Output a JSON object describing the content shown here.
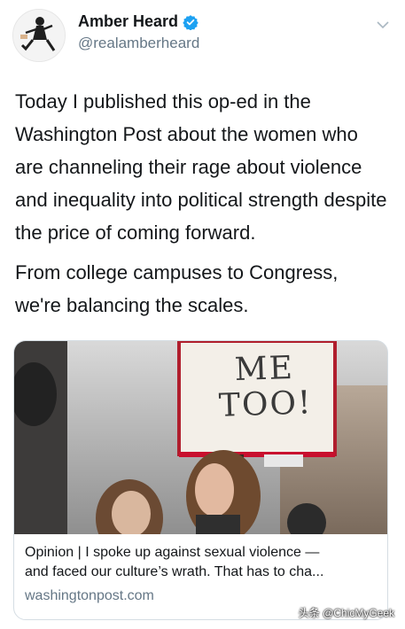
{
  "tweet": {
    "display_name": "Amber Heard",
    "handle": "@realamberheard",
    "text_paragraphs": [
      "Today I published this op-ed in the Washington Post about the women who are channeling their rage about violence and inequality into political strength despite the price of coming forward.",
      "From college campuses to Congress, we're balancing the scales."
    ]
  },
  "card": {
    "sign_line1": "ME",
    "sign_line2": "TOO!",
    "title_line1": "Opinion | I spoke up against sexual violence —",
    "title_line2": "and faced our culture’s wrath. That has to cha...",
    "domain": "washingtonpost.com"
  },
  "watermark": "头条 @ChicMyGeek",
  "colors": {
    "verified": "#1da1f2",
    "secondary_text": "#657786",
    "card_border": "#d5dde3"
  },
  "icons": {
    "verified": "verified-badge-icon",
    "menu": "chevron-down-icon"
  }
}
